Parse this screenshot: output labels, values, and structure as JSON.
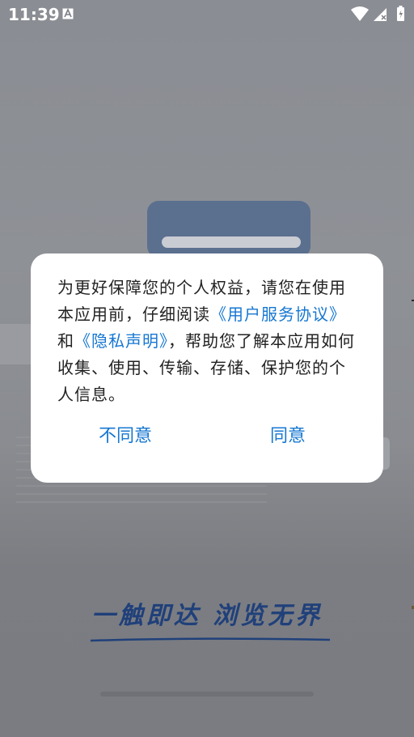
{
  "status_bar": {
    "time": "11:39",
    "left_icon": "font-a-icon",
    "right_icons": [
      "wifi-icon",
      "signal-icon",
      "battery-charging-icon"
    ]
  },
  "background": {
    "slogan": "一触即达 浏览无界"
  },
  "dialog": {
    "text_before": "为更好保障您的个人权益，请您在使用本应用前，仔细阅读",
    "user_agreement_link": "《用户服务协议》",
    "and_text": "和",
    "privacy_link": "《隐私声明》",
    "text_after": "，帮助您了解本应用如何收集、使用、传输、存储、保护您的个人信息。",
    "disagree_label": "不同意",
    "agree_label": "同意"
  },
  "colors": {
    "link": "#1677d2",
    "dialog_bg": "#ffffff",
    "overlay": "#7c7f86"
  }
}
